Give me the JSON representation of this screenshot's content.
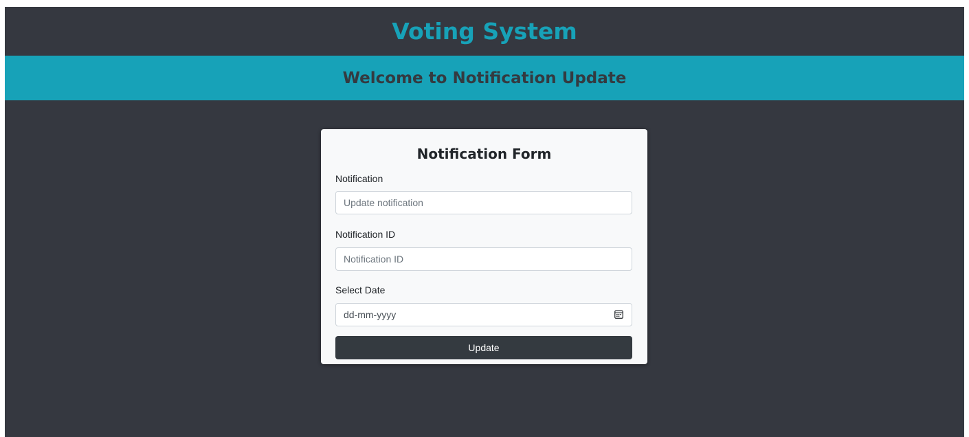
{
  "header": {
    "title": "Voting System",
    "banner": "Welcome to Notification Update"
  },
  "form": {
    "title": "Notification Form",
    "notification": {
      "label": "Notification",
      "placeholder": "Update notification",
      "value": ""
    },
    "notification_id": {
      "label": "Notification ID",
      "placeholder": "Notification ID",
      "value": ""
    },
    "date": {
      "label": "Select Date",
      "placeholder": "dd-mm-yyyy",
      "icon": "calendar-icon"
    },
    "submit_label": "Update"
  },
  "colors": {
    "page_background": "#353840",
    "accent": "#17a2b8",
    "banner_text": "#343a40",
    "card_background": "#f8f9fa",
    "button_background": "#343a40"
  }
}
